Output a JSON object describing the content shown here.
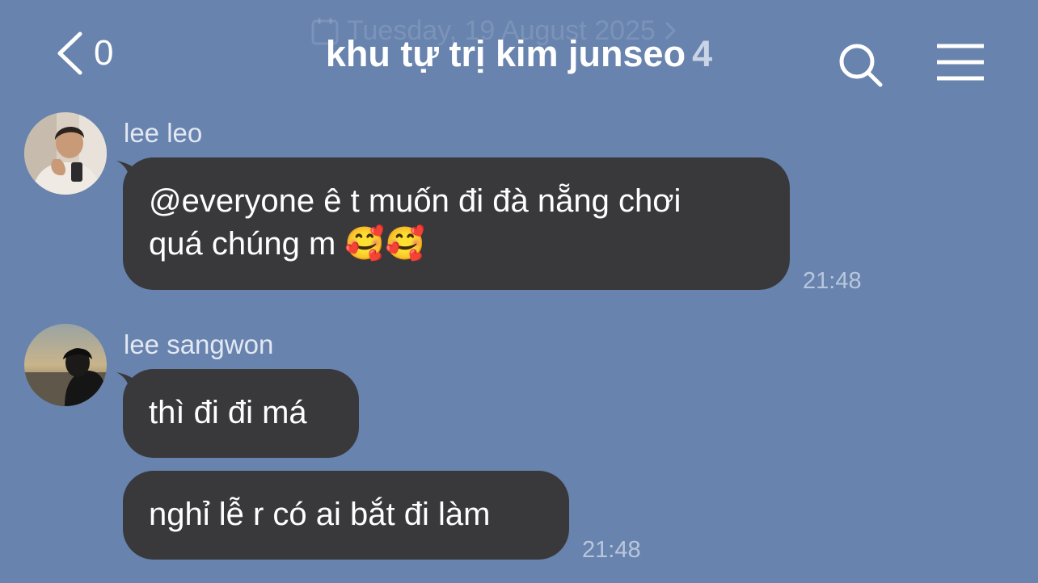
{
  "header": {
    "date_divider": "Tuesday, 19 August 2025",
    "back_count": "0",
    "title": "khu tự trị kim junseo",
    "member_count": "4"
  },
  "messages": [
    {
      "sender": "lee leo",
      "bubbles": [
        {
          "lines": [
            "@everyone ê t muốn đi đà nẵng chơi",
            "quá chúng m 🥰🥰"
          ]
        }
      ],
      "time": "21:48"
    },
    {
      "sender": "lee sangwon",
      "bubbles": [
        {
          "lines": [
            "thì đi đi má"
          ]
        },
        {
          "lines": [
            "nghỉ lễ r có ai bắt đi làm"
          ]
        }
      ],
      "time": "21:48"
    }
  ],
  "colors": {
    "background": "#6883AE",
    "bubble": "#39393C",
    "timestamp": "#B9C7DC"
  }
}
